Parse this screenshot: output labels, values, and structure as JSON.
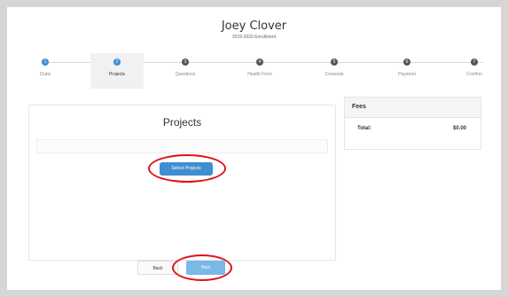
{
  "header": {
    "student_name": "Joey Clover",
    "enrollment": "2019-2020 Enrollment"
  },
  "steps": [
    {
      "number": "1",
      "label": "Clubs",
      "state": "complete"
    },
    {
      "number": "2",
      "label": "Projects",
      "state": "active"
    },
    {
      "number": "3",
      "label": "Questions",
      "state": "pending"
    },
    {
      "number": "4",
      "label": "Health Form",
      "state": "pending"
    },
    {
      "number": "5",
      "label": "Consents",
      "state": "pending"
    },
    {
      "number": "6",
      "label": "Payment",
      "state": "pending"
    },
    {
      "number": "7",
      "label": "Confirm",
      "state": "pending"
    }
  ],
  "projects": {
    "title": "Projects",
    "select_button": "Select Projects"
  },
  "fees": {
    "title": "Fees",
    "total_label": "Total:",
    "total_value": "$0.00"
  },
  "nav": {
    "back_label": "Back",
    "next_label": "Next"
  },
  "colors": {
    "accent": "#3f8fd0",
    "highlight": "#e0121c"
  }
}
